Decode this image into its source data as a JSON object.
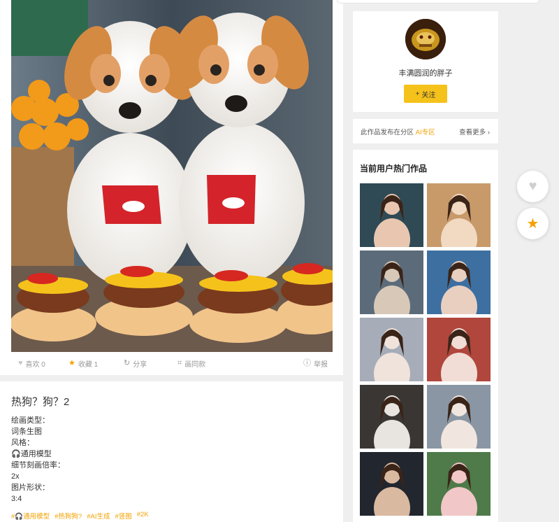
{
  "artwork": {
    "image_alt": "two puppies with hot dogs",
    "actions": {
      "like_label": "喜欢 0",
      "favorite_label": "收藏 1",
      "share_label": "分享",
      "same_style_label": "画同款",
      "report_label": "举报"
    }
  },
  "description": {
    "title": "热狗？狗？2",
    "lines": [
      "绘画类型：",
      "词条生图",
      "风格：",
      "🎧通用模型",
      "细节刻画倍率：",
      "2x",
      "图片形状：",
      "3:4"
    ],
    "tags": [
      "#🎧通用模型",
      "#热狗狗?",
      "#AI生成",
      "#竖图",
      "#2K"
    ]
  },
  "author": {
    "name": "丰满圆润的胖子",
    "follow_label": "关注",
    "follow_icon": "+"
  },
  "zone": {
    "prefix": "此作品发布在分区",
    "zone_name": "AI专区",
    "more_label": "查看更多",
    "more_icon": "›"
  },
  "hot_works": {
    "title": "当前用户热门作品",
    "items": [
      {
        "name": "thumb-1",
        "palette": [
          "#2f4a55",
          "#e8c6b0"
        ]
      },
      {
        "name": "thumb-2",
        "palette": [
          "#c89a6a",
          "#f2d9c2"
        ]
      },
      {
        "name": "thumb-3",
        "palette": [
          "#5c6b7a",
          "#d7c8b8"
        ]
      },
      {
        "name": "thumb-4",
        "palette": [
          "#3d6fa0",
          "#e9cfc0"
        ]
      },
      {
        "name": "thumb-5",
        "palette": [
          "#a6acb8",
          "#efe3dc"
        ]
      },
      {
        "name": "thumb-6",
        "palette": [
          "#b0463c",
          "#f1ddd5"
        ]
      },
      {
        "name": "thumb-7",
        "palette": [
          "#3a3633",
          "#e8e4e0"
        ]
      },
      {
        "name": "thumb-8",
        "palette": [
          "#8a96a3",
          "#f0e6df"
        ]
      },
      {
        "name": "thumb-9",
        "palette": [
          "#22262e",
          "#d9b9a0"
        ]
      },
      {
        "name": "thumb-10",
        "palette": [
          "#4f7a4a",
          "#f2c7c7"
        ]
      }
    ]
  },
  "floating": {
    "like_icon": "♥",
    "favorite_icon": "★"
  },
  "colors": {
    "accent": "#f5c21b",
    "tag": "#f2a100",
    "star": "#f2a100"
  }
}
